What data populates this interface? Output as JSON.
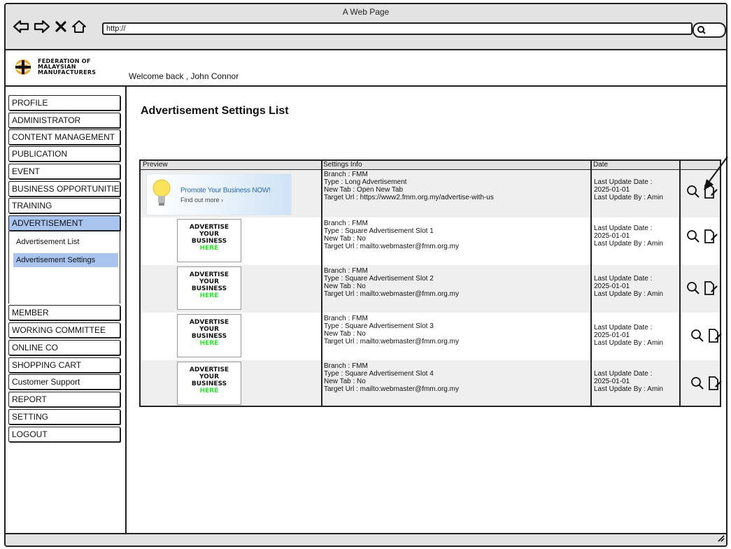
{
  "window": {
    "title": "A Web Page",
    "url": "http://"
  },
  "header": {
    "logo_line1": "FEDERATION OF",
    "logo_line2": "MALAYSIAN",
    "logo_line3": "MANUFACTURERS",
    "welcome": "Welcome back , John Connor"
  },
  "sidebar": {
    "items": [
      {
        "label": "PROFILE"
      },
      {
        "label": "ADMINISTRATOR"
      },
      {
        "label": "CONTENT MANAGEMENT"
      },
      {
        "label": "PUBLICATION"
      },
      {
        "label": "EVENT"
      },
      {
        "label": "BUSINESS OPPORTUNITIES"
      },
      {
        "label": "TRAINING"
      },
      {
        "label": "ADVERTISEMENT"
      },
      {
        "label": "MEMBER"
      },
      {
        "label": "WORKING COMMITTEE"
      },
      {
        "label": "ONLINE CO"
      },
      {
        "label": "SHOPPING CART"
      },
      {
        "label": "Customer Support"
      },
      {
        "label": "REPORT"
      },
      {
        "label": "SETTING"
      },
      {
        "label": "LOGOUT"
      }
    ],
    "submenu": [
      {
        "label": "Advertisement List"
      },
      {
        "label": "Advertisement Settings"
      }
    ]
  },
  "main": {
    "title": "Advertisement Settings List",
    "table": {
      "headers": [
        "Preview",
        "Settings Info",
        "Date",
        ""
      ],
      "banner": {
        "line1": "Promote Your Business NOW!",
        "line2": "Find out more ›"
      },
      "ad_placeholder": {
        "line1": "ADVERTISE",
        "line2": "YOUR",
        "line3": "BUSINESS",
        "line4": "HERE"
      },
      "rows": [
        {
          "branch": "Branch : FMM",
          "type": "Type : Long Advertisement",
          "new_tab": "New Tab :  Open New Tab",
          "target": "Target Url : https://www2.fmm.org.my/advertise-with-us",
          "date_label": "Last Update Date :",
          "date": "2025-01-01",
          "by": "Last Update By : Amin"
        },
        {
          "branch": "Branch : FMM",
          "type": "Type : Square Advertisement Slot 1",
          "new_tab": "New Tab : No",
          "target": "Target Url : mailto:webmaster@fmm.org.my",
          "date_label": "Last Update Date :",
          "date": "2025-01-01",
          "by": "Last Update By : Amin"
        },
        {
          "branch": "Branch : FMM",
          "type": "Type : Square Advertisement Slot 2",
          "new_tab": "New Tab : No",
          "target": "Target Url : mailto:webmaster@fmm.org.my",
          "date_label": "Last Update Date :",
          "date": "2025-01-01",
          "by": "Last Update By : Amin"
        },
        {
          "branch": "Branch : FMM",
          "type": "Type : Square Advertisement Slot 3",
          "new_tab": "New Tab : No",
          "target": "Target Url : mailto:webmaster@fmm.org.my",
          "date_label": "Last Update Date :",
          "date": "2025-01-01",
          "by": "Last Update By : Amin"
        },
        {
          "branch": "Branch : FMM",
          "type": "Type : Square Advertisement Slot 4",
          "new_tab": "New Tab : No",
          "target": "Target Url : mailto:webmaster@fmm.org.my",
          "date_label": "Last Update Date :",
          "date": "2025-01-01",
          "by": "Last Update By : Amin"
        }
      ]
    }
  },
  "colors": {
    "active_menu": "#a8c4ef",
    "chrome_gray": "#e3e3e3",
    "here_green": "#2ee52e",
    "banner_blue": "#2a66b6"
  },
  "icons": {
    "nav": [
      "back-arrow-icon",
      "forward-arrow-icon",
      "close-icon",
      "home-icon"
    ],
    "actions": [
      "search-icon",
      "edit-icon"
    ]
  }
}
